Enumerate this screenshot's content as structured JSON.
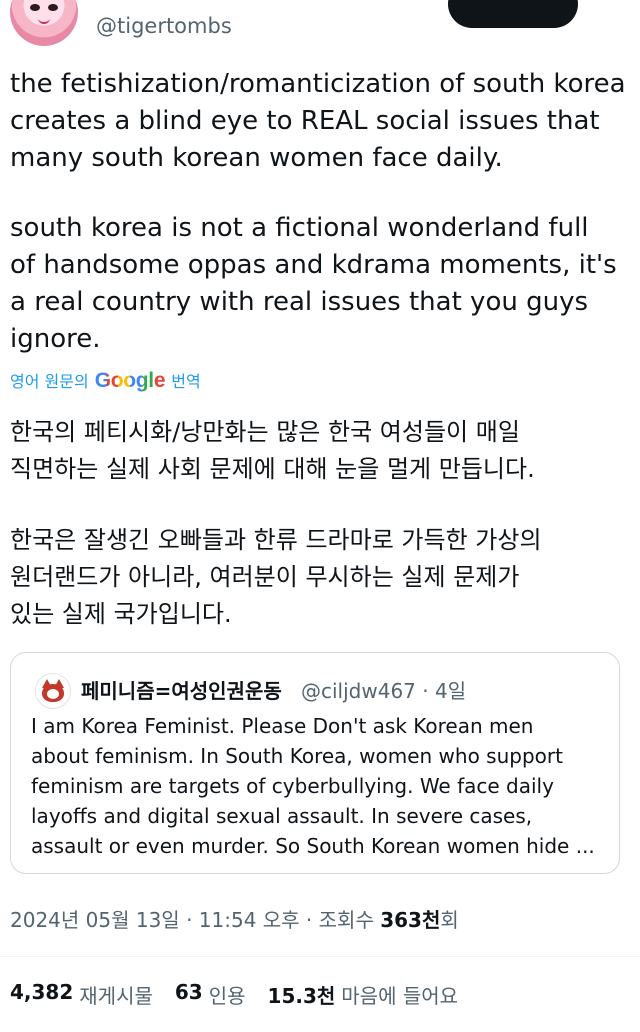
{
  "author": {
    "handle": "@tigertombs",
    "avatar_icon": "anime-avatar-icon"
  },
  "tweet": {
    "paragraph1": [
      "the fetishization/romanticization of south korea",
      "creates a blind eye to REAL social issues that",
      "many south korean women face daily."
    ],
    "paragraph2": [
      "south korea is not a fictional wonderland full",
      "of handsome oppas and kdrama moments, it's",
      "a real country with real issues that you guys",
      "ignore."
    ]
  },
  "translation": {
    "prefix": "영어 원문의",
    "brand": "Google",
    "suffix": "번역",
    "paragraph1": [
      "한국의 페티시화/낭만화는 많은 한국 여성들이 매일",
      "직면하는 실제 사회 문제에 대해 눈을 멀게 만듭니다."
    ],
    "paragraph2": [
      "한국은 잘생긴 오빠들과 한류 드라마로 가득한 가상의",
      "원더랜드가 아니라, 여러분이 무시하는 실제 문제가",
      "있는 실제 국가입니다."
    ]
  },
  "quote": {
    "name": "페미니즘=여성인권운동",
    "meta": "@ciljdw467 · 4일",
    "avatar_icon": "cat-avatar-icon",
    "lines": [
      "I am Korea Feminist. Please Don't ask Korean men",
      "about feminism. In South Korea, women who support",
      "feminism are targets of cyberbullying. We face daily",
      "layoffs and digital sexual assault. In severe cases,",
      "assault or even murder. So South Korean women hide ..."
    ]
  },
  "timestamp": {
    "date_time": "2024년 05월 13일 · 11:54 오후 · 조회수 ",
    "views_num": "363천",
    "views_suffix": "회"
  },
  "stats": {
    "reposts_num": "4,382",
    "reposts_label": "재게시물",
    "quotes_num": "63",
    "quotes_label": "인용",
    "likes_num": "15.3천",
    "likes_label": "마음에 들어요"
  },
  "colors": {
    "text": "#0f1419",
    "secondary": "#536471",
    "link": "#1d9bf0",
    "border": "#cfd9de"
  }
}
